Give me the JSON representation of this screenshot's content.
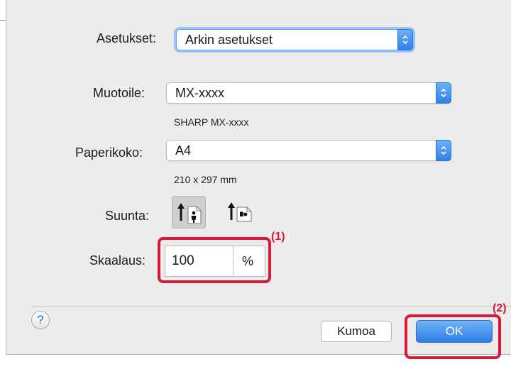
{
  "settings": {
    "label": "Asetukset:",
    "value": "Arkin asetukset"
  },
  "format": {
    "label": "Muotoile:",
    "value": "MX-xxxx",
    "detail": "SHARP MX-xxxx"
  },
  "paper": {
    "label": "Paperikoko:",
    "value": "A4",
    "detail": "210 x 297 mm"
  },
  "orientation": {
    "label": "Suunta:",
    "options": [
      "portrait",
      "landscape"
    ],
    "selected": "portrait"
  },
  "scale": {
    "label": "Skaalaus:",
    "value": "100",
    "unit": "%"
  },
  "callouts": {
    "scale": "(1)",
    "ok": "(2)"
  },
  "buttons": {
    "help": "?",
    "cancel": "Kumoa",
    "ok": "OK"
  },
  "colors": {
    "accent": "#2f80e6",
    "highlight": "#d7193a",
    "dialog_bg": "#ececec"
  },
  "icons": {
    "select_arrows": "up-down-chevron-icon",
    "portrait": "portrait-orientation-icon",
    "landscape": "landscape-orientation-icon"
  }
}
